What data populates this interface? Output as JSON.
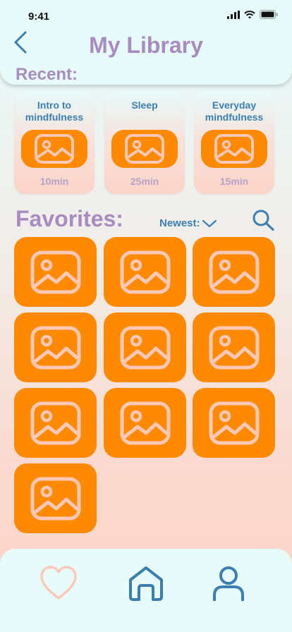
{
  "status_bar": {
    "time": "9:41"
  },
  "header": {
    "title": "My Library"
  },
  "recent": {
    "label": "Recent:",
    "items": [
      {
        "title": "Intro to mindfulness",
        "duration": "10min"
      },
      {
        "title": "Sleep",
        "duration": "25min"
      },
      {
        "title": "Everyday mindfulness",
        "duration": "15min"
      }
    ]
  },
  "favorites": {
    "label": "Favorites:",
    "sort_label": "Newest:",
    "tile_count": 10
  },
  "icons": {
    "back": "chevron-left-icon",
    "search": "search-icon",
    "dropdown": "chevron-down-icon",
    "image": "image-placeholder-icon",
    "nav": [
      "heart-icon",
      "home-icon",
      "user-icon"
    ]
  },
  "colors": {
    "accent_orange": "#ff8a00",
    "title_purple": "#a88bc0",
    "link_blue": "#3a7fb0",
    "icon_pink": "#fcc8b8",
    "panel_bg": "#e8fbfb"
  }
}
